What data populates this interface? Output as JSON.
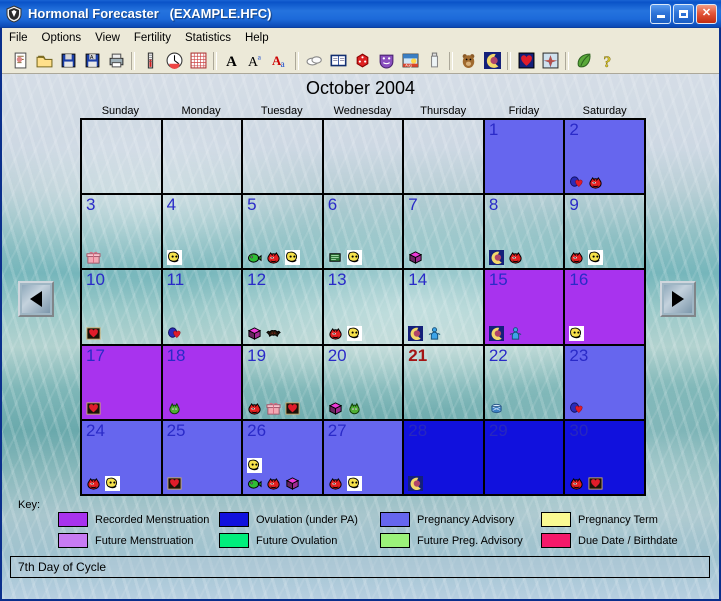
{
  "window": {
    "title": "Hormonal Forecaster   (EXAMPLE.HFC)",
    "icon": "app-shield-icon",
    "minimize_label": "Minimize",
    "maximize_label": "Maximize",
    "close_label": "Close"
  },
  "menu": {
    "items": [
      {
        "label": "File"
      },
      {
        "label": "Options"
      },
      {
        "label": "View"
      },
      {
        "label": "Fertility"
      },
      {
        "label": "Statistics"
      },
      {
        "label": "Help"
      }
    ]
  },
  "toolbar": {
    "groups": [
      {
        "buttons": [
          {
            "name": "new-document-icon",
            "tip": "New"
          },
          {
            "name": "open-folder-icon",
            "tip": "Open"
          },
          {
            "name": "save-disk-icon",
            "tip": "Save"
          },
          {
            "name": "save-as-disk-icon",
            "tip": "Save As"
          },
          {
            "name": "print-icon",
            "tip": "Print"
          }
        ]
      },
      {
        "buttons": [
          {
            "name": "thermometer-icon",
            "tip": "Temperature"
          },
          {
            "name": "clock-icon",
            "tip": "Time"
          },
          {
            "name": "grid-chart-icon",
            "tip": "Chart"
          }
        ]
      },
      {
        "buttons": [
          {
            "name": "font-bold-a-icon",
            "tip": "Font"
          },
          {
            "name": "font-size-a-icon",
            "tip": "Font Size"
          },
          {
            "name": "font-color-a-icon",
            "tip": "Font Color"
          }
        ]
      },
      {
        "buttons": [
          {
            "name": "clouds-icon",
            "tip": "Mood"
          },
          {
            "name": "book-icon",
            "tip": "Journal"
          },
          {
            "name": "dice-icon",
            "tip": "Random"
          },
          {
            "name": "masks-icon",
            "tip": "Theater"
          },
          {
            "name": "calendar-aug-icon",
            "tip": "Calendar"
          },
          {
            "name": "bottle-icon",
            "tip": "Bottle"
          }
        ]
      },
      {
        "buttons": [
          {
            "name": "bear-icon",
            "tip": "Bear"
          },
          {
            "name": "moon-icon",
            "tip": "Moon"
          }
        ]
      },
      {
        "buttons": [
          {
            "name": "heart-card-icon",
            "tip": "Love"
          },
          {
            "name": "compass-icon",
            "tip": "Compass"
          }
        ]
      },
      {
        "buttons": [
          {
            "name": "leaf-icon",
            "tip": "Herb"
          },
          {
            "name": "help-question-icon",
            "tip": "Help"
          }
        ]
      }
    ]
  },
  "calendar": {
    "month_title": "October 2004",
    "day_names": [
      "Sunday",
      "Monday",
      "Tuesday",
      "Wednesday",
      "Thursday",
      "Friday",
      "Saturday"
    ],
    "prev_label": "Previous Month",
    "next_label": "Next Month",
    "colors": {
      "recorded_menstruation": "#A833EE",
      "future_menstruation": "#C77BF3",
      "ovulation_under_pa": "#1111DD",
      "future_ovulation": "#00EE7C",
      "pregnancy_advisory": "#6666EE",
      "future_preg_advisory": "#9BF27A",
      "pregnancy_term": "#FAFA92",
      "due_date_birthdate": "#F5186A",
      "none": "transparent"
    },
    "weeks": [
      [
        {
          "day": "",
          "fill": "none",
          "icons": []
        },
        {
          "day": "",
          "fill": "none",
          "icons": []
        },
        {
          "day": "",
          "fill": "none",
          "icons": []
        },
        {
          "day": "",
          "fill": "none",
          "icons": []
        },
        {
          "day": "",
          "fill": "none",
          "icons": []
        },
        {
          "day": "1",
          "fill": "pregnancy_advisory",
          "icons": []
        },
        {
          "day": "2",
          "fill": "pregnancy_advisory",
          "icons": [
            "heart-balloon-icon",
            "red-face-icon"
          ]
        }
      ],
      [
        {
          "day": "3",
          "fill": "none",
          "icons": [
            "pink-gift-icon"
          ]
        },
        {
          "day": "4",
          "fill": "none",
          "icons": [
            "yellow-face-icon"
          ]
        },
        {
          "day": "5",
          "fill": "none",
          "icons": [
            "green-fish-icon",
            "red-face-icon",
            "yellow-face-icon"
          ]
        },
        {
          "day": "6",
          "fill": "none",
          "icons": [
            "green-note-icon",
            "yellow-face-icon"
          ]
        },
        {
          "day": "7",
          "fill": "none",
          "icons": [
            "magenta-cube-icon"
          ]
        },
        {
          "day": "8",
          "fill": "none",
          "icons": [
            "moon-icon",
            "red-face-icon"
          ]
        },
        {
          "day": "9",
          "fill": "none",
          "icons": [
            "red-face-icon",
            "yellow-face-icon"
          ]
        }
      ],
      [
        {
          "day": "10",
          "fill": "none",
          "icons": [
            "black-heart-card-icon"
          ]
        },
        {
          "day": "11",
          "fill": "none",
          "icons": [
            "heart-balloon-icon"
          ]
        },
        {
          "day": "12",
          "fill": "none",
          "icons": [
            "magenta-cube-icon",
            "bat-icon"
          ]
        },
        {
          "day": "13",
          "fill": "none",
          "icons": [
            "red-face-icon",
            "yellow-face-icon"
          ]
        },
        {
          "day": "14",
          "fill": "none",
          "icons": [
            "moon-icon",
            "blue-person-icon"
          ]
        },
        {
          "day": "15",
          "fill": "recorded_menstruation",
          "icons": [
            "moon-icon",
            "blue-person-icon"
          ]
        },
        {
          "day": "16",
          "fill": "recorded_menstruation",
          "icons": [
            "yellow-face-icon"
          ]
        }
      ],
      [
        {
          "day": "17",
          "fill": "recorded_menstruation",
          "icons": [
            "black-heart-card-icon"
          ]
        },
        {
          "day": "18",
          "fill": "recorded_menstruation",
          "icons": [
            "green-creature-icon"
          ]
        },
        {
          "day": "19",
          "fill": "none",
          "icons": [
            "red-face-icon",
            "pink-gift-icon",
            "black-heart-card-icon"
          ]
        },
        {
          "day": "20",
          "fill": "none",
          "icons": [
            "magenta-cube-icon",
            "green-creature-icon"
          ]
        },
        {
          "day": "21",
          "fill": "none",
          "today": true,
          "icons": []
        },
        {
          "day": "22",
          "fill": "none",
          "icons": [
            "blue-drum-icon"
          ]
        },
        {
          "day": "23",
          "fill": "pregnancy_advisory",
          "icons": [
            "heart-balloon-icon"
          ]
        }
      ],
      [
        {
          "day": "24",
          "fill": "pregnancy_advisory",
          "icons": [
            "red-face-icon",
            "yellow-face-icon"
          ]
        },
        {
          "day": "25",
          "fill": "pregnancy_advisory",
          "icons": [
            "black-heart-card-icon"
          ]
        },
        {
          "day": "26",
          "fill": "pregnancy_advisory",
          "stack_first": true,
          "icons": [
            "yellow-face-icon",
            "green-fish-icon",
            "red-face-icon",
            "magenta-cube-icon"
          ]
        },
        {
          "day": "27",
          "fill": "pregnancy_advisory",
          "icons": [
            "red-face-icon",
            "yellow-face-icon"
          ]
        },
        {
          "day": "28",
          "fill": "ovulation_under_pa",
          "dim": true,
          "icons": [
            "moon-icon"
          ]
        },
        {
          "day": "29",
          "fill": "ovulation_under_pa",
          "dim": true,
          "icons": []
        },
        {
          "day": "30",
          "fill": "ovulation_under_pa",
          "dim": true,
          "icons": [
            "red-face-icon",
            "black-heart-card-icon"
          ]
        }
      ]
    ]
  },
  "key": {
    "label": "Key:",
    "items": [
      {
        "color": "#A833EE",
        "label": "Recorded Menstruation"
      },
      {
        "color": "#1111DD",
        "label": "Ovulation (under PA)"
      },
      {
        "color": "#6666EE",
        "label": "Pregnancy Advisory"
      },
      {
        "color": "#FAFA92",
        "label": "Pregnancy Term"
      },
      {
        "color": "#C77BF3",
        "label": "Future Menstruation"
      },
      {
        "color": "#00EE7C",
        "label": "Future Ovulation"
      },
      {
        "color": "#9BF27A",
        "label": "Future Preg. Advisory"
      },
      {
        "color": "#F5186A",
        "label": "Due Date / Birthdate"
      }
    ]
  },
  "status": {
    "text": "7th Day of Cycle"
  }
}
